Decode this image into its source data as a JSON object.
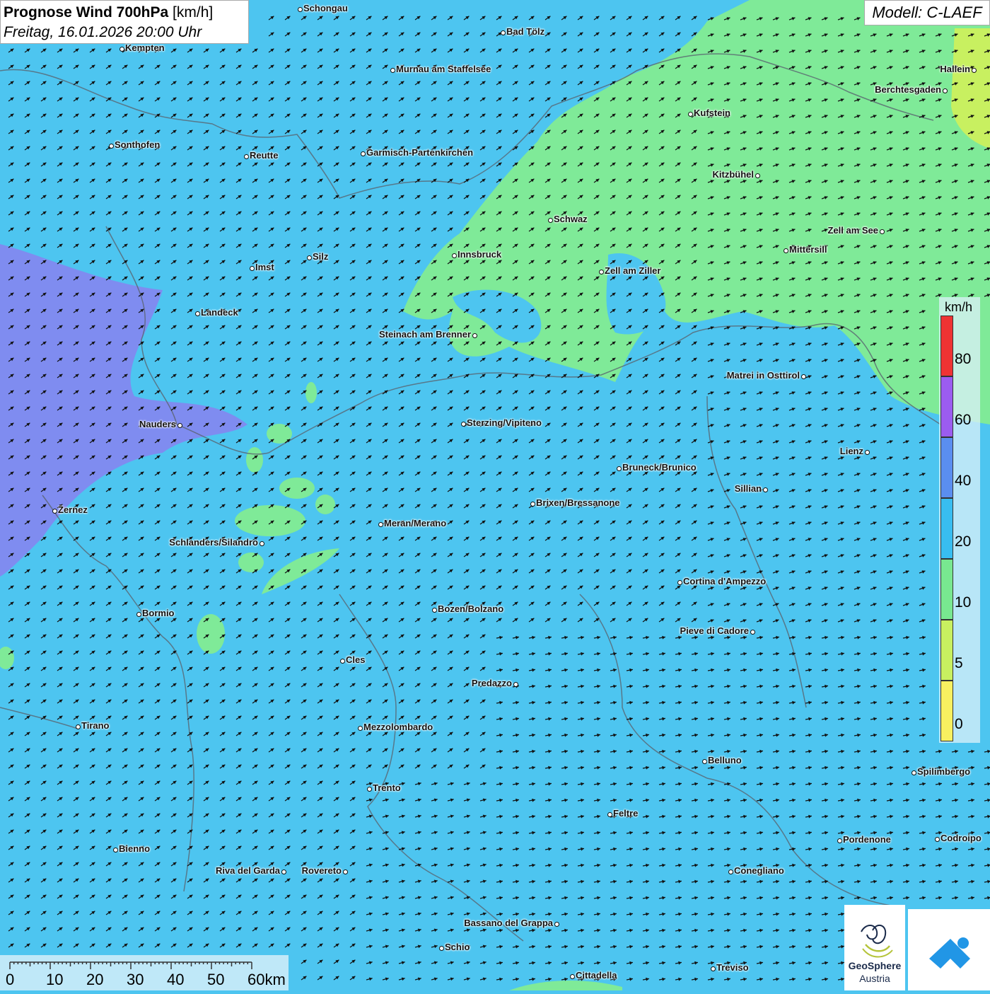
{
  "header": {
    "title_bold": "Prognose Wind 700hPa",
    "title_unit": "[km/h]",
    "subtitle": "Freitag, 16.01.2026 20:00 Uhr",
    "model": "Modell: C-LAEF"
  },
  "legend": {
    "unit": "km/h",
    "ticks": [
      "80",
      "60",
      "40",
      "20",
      "10",
      "5",
      "0"
    ],
    "colors": [
      "#ee3333",
      "#9b5cf0",
      "#5a8ef0",
      "#38bdf0",
      "#78e890",
      "#c8f060",
      "#f8f060"
    ]
  },
  "scalebar": {
    "labels": [
      "0",
      "10",
      "20",
      "30",
      "40",
      "50",
      "60km"
    ]
  },
  "branding": {
    "name": "GeoSphere",
    "sub": "Austria"
  },
  "cities": [
    {
      "name": "Schongau"
    },
    {
      "name": "Bad Tölz"
    },
    {
      "name": "Kempten"
    },
    {
      "name": "Murnau am Staffelsee"
    },
    {
      "name": "Hallein"
    },
    {
      "name": "Berchtesgaden"
    },
    {
      "name": "Kufstein"
    },
    {
      "name": "Sonthofen"
    },
    {
      "name": "Reutte"
    },
    {
      "name": "Garmisch-Partenkirchen"
    },
    {
      "name": "Kitzbühel"
    },
    {
      "name": "Schwaz"
    },
    {
      "name": "Zell am See"
    },
    {
      "name": "Mittersill"
    },
    {
      "name": "Innsbruck"
    },
    {
      "name": "Silz"
    },
    {
      "name": "Imst"
    },
    {
      "name": "Zell am Ziller"
    },
    {
      "name": "Landeck"
    },
    {
      "name": "Steinach am Brenner"
    },
    {
      "name": "Matrei in Osttirol"
    },
    {
      "name": "Nauders"
    },
    {
      "name": "Sterzing/Vipiteno"
    },
    {
      "name": "Lienz"
    },
    {
      "name": "Bruneck/Brunico"
    },
    {
      "name": "Sillian"
    },
    {
      "name": "Zernez"
    },
    {
      "name": "Brixen/Bressanone"
    },
    {
      "name": "Meran/Merano"
    },
    {
      "name": "Schlanders/Silandro"
    },
    {
      "name": "Cortina d'Ampezzo"
    },
    {
      "name": "Bozen/Bolzano"
    },
    {
      "name": "Bormio"
    },
    {
      "name": "Pieve di Cadore"
    },
    {
      "name": "Cles"
    },
    {
      "name": "Predazzo"
    },
    {
      "name": "Tirano"
    },
    {
      "name": "Mezzolombardo"
    },
    {
      "name": "Belluno"
    },
    {
      "name": "Spilimbergo"
    },
    {
      "name": "Trento"
    },
    {
      "name": "Feltre"
    },
    {
      "name": "Pordenone"
    },
    {
      "name": "Codroipo"
    },
    {
      "name": "Bienno"
    },
    {
      "name": "Riva del Garda"
    },
    {
      "name": "Rovereto"
    },
    {
      "name": "Conegliano"
    },
    {
      "name": "Bassano del Grappa"
    },
    {
      "name": "Schio"
    },
    {
      "name": "Treviso"
    },
    {
      "name": "Cittadella"
    }
  ]
}
